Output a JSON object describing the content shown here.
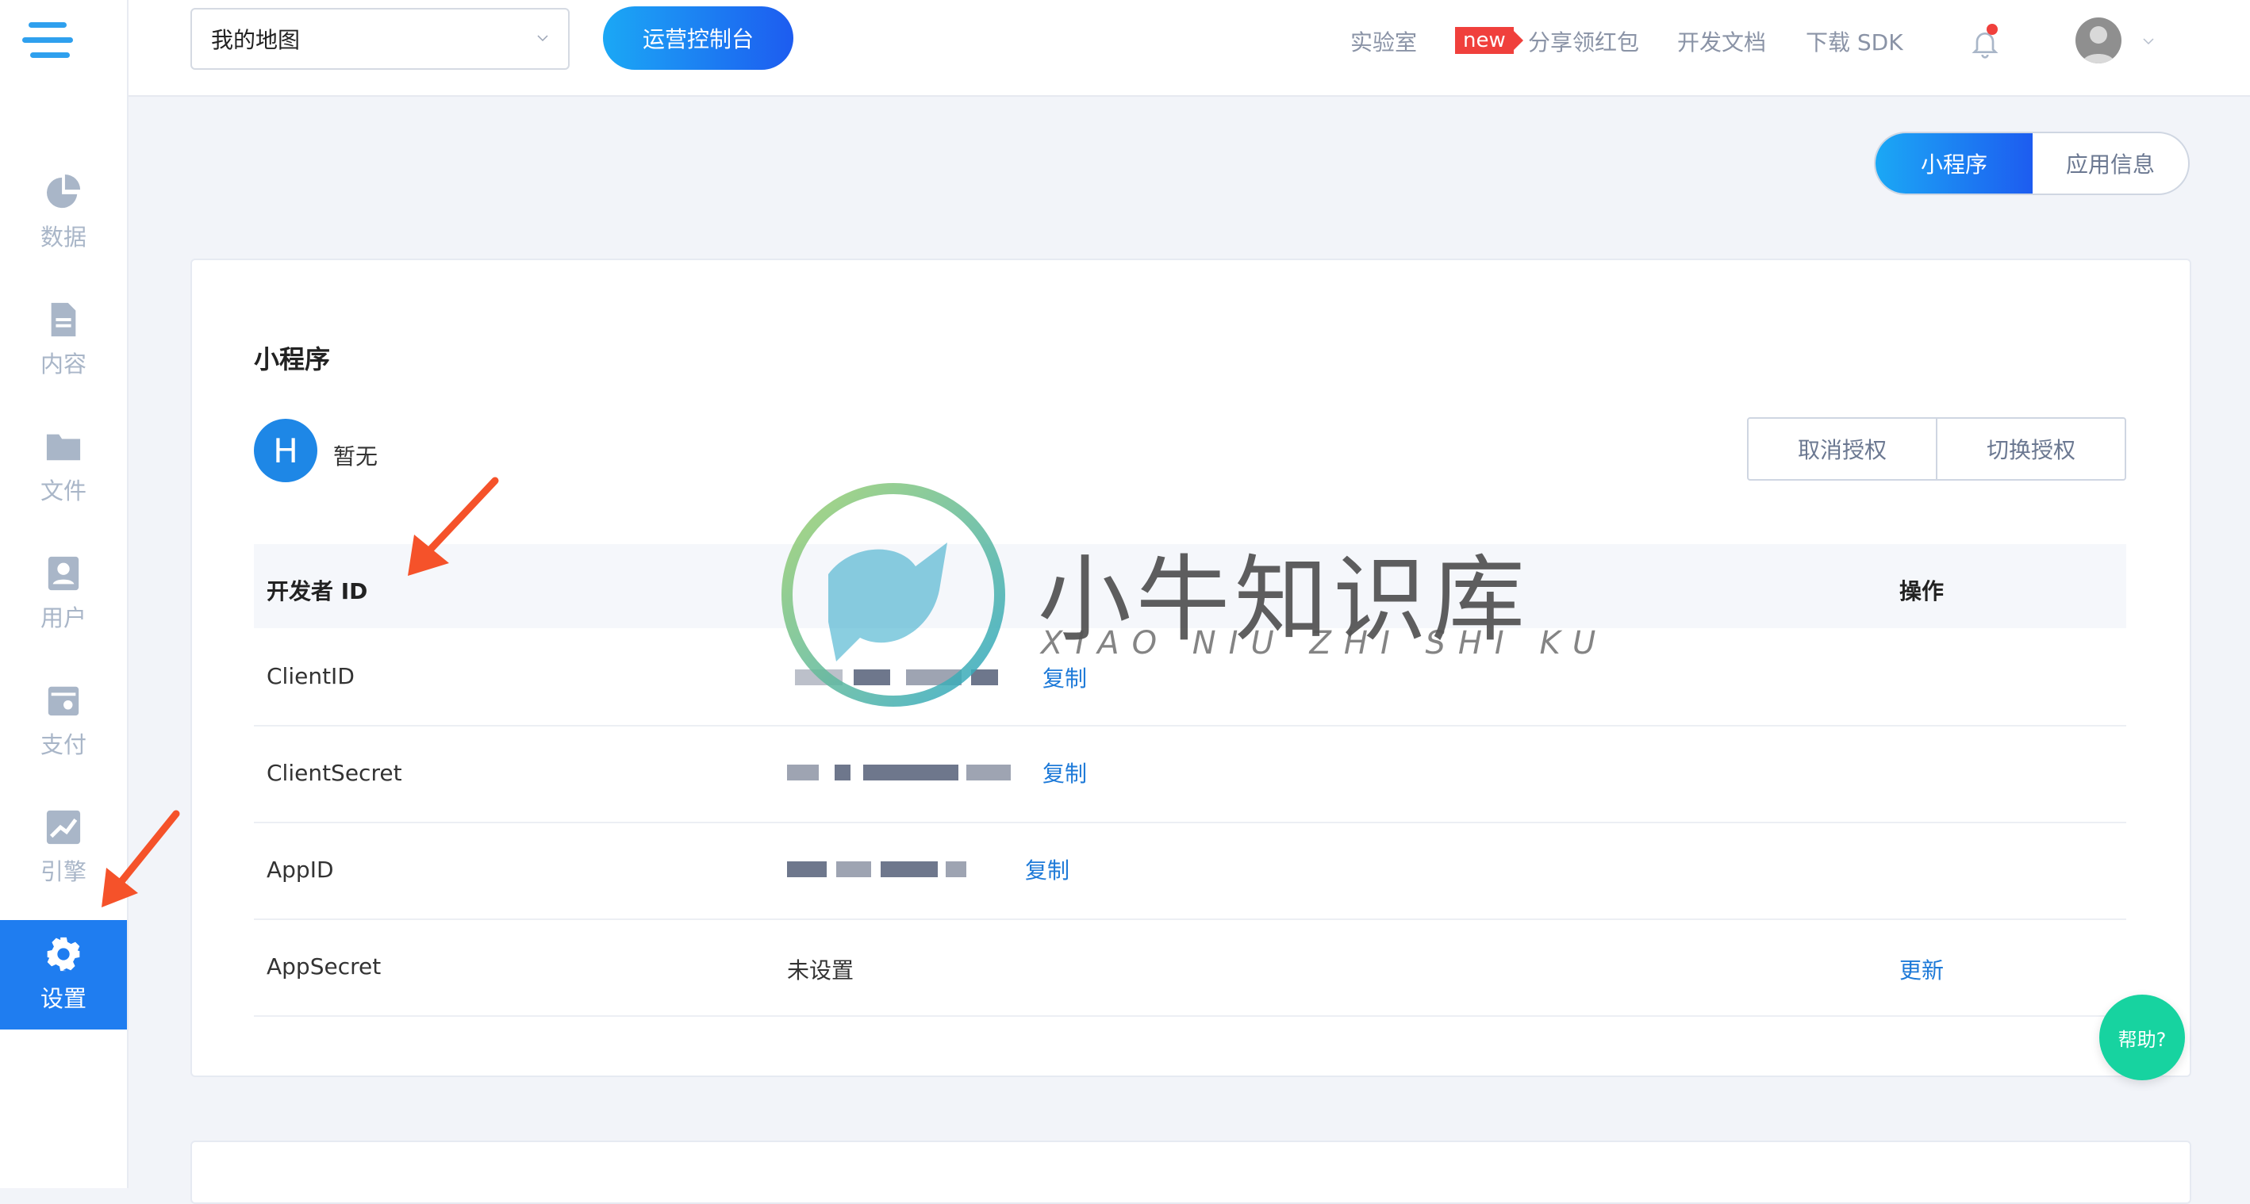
{
  "sidebar": {
    "items": [
      {
        "label": "数据",
        "icon": "pie-chart-icon"
      },
      {
        "label": "内容",
        "icon": "document-icon"
      },
      {
        "label": "文件",
        "icon": "folder-icon"
      },
      {
        "label": "用户",
        "icon": "user-card-icon"
      },
      {
        "label": "支付",
        "icon": "wallet-icon"
      },
      {
        "label": "引擎",
        "icon": "trend-chart-icon"
      },
      {
        "label": "设置",
        "icon": "gear-icon",
        "active": true
      }
    ]
  },
  "header": {
    "map_select": "我的地图",
    "console_button": "运营控制台",
    "links": {
      "lab": "实验室",
      "new_badge": "new",
      "share": "分享领红包",
      "docs": "开发文档",
      "sdk": "下载 SDK"
    }
  },
  "tabs": {
    "miniprogram": "小程序",
    "appinfo": "应用信息"
  },
  "card": {
    "title": "小程序",
    "avatar_letter": "H",
    "name": "暂无",
    "cancel_auth": "取消授权",
    "switch_auth": "切换授权",
    "table": {
      "headers": {
        "key": "开发者 ID",
        "op": "操作"
      },
      "rows": [
        {
          "key": "ClientID",
          "value": "",
          "copy": "复制",
          "op": ""
        },
        {
          "key": "ClientSecret",
          "value": "",
          "copy": "复制",
          "op": ""
        },
        {
          "key": "AppID",
          "value": "",
          "copy": "复制",
          "op": ""
        },
        {
          "key": "AppSecret",
          "value": "未设置",
          "copy": "",
          "op": "更新"
        }
      ]
    }
  },
  "help_button": "帮助?",
  "watermark": {
    "cn": "小牛知识库",
    "en": "XIAO NIU ZHI SHI KU"
  },
  "colors": {
    "accent": "#1f7df0",
    "help": "#17d3a0",
    "badge": "#f0403c",
    "arrow": "#f5522a"
  }
}
